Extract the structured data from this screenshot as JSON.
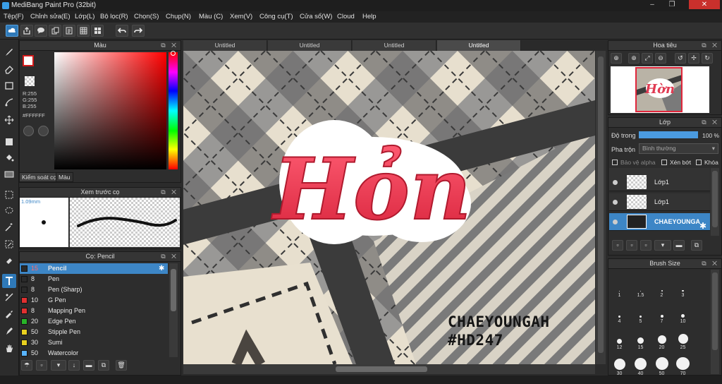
{
  "window": {
    "title": "MediBang Paint Pro (32bit)",
    "minimize": "–",
    "restore": "❐",
    "close": "✕"
  },
  "menu": [
    "Tệp(F)",
    "Chỉnh sửa(E)",
    "Lớp(L)",
    "Bộ lọc(R)",
    "Chọn(S)",
    "Chụp(N)",
    "Màu (C)",
    "Xem(V)",
    "Công cụ(T)",
    "Cửa sổ(W)",
    "Cloud",
    "Help"
  ],
  "color_panel": {
    "title": "Màu",
    "rgb": [
      "R:255",
      "G:255",
      "B:255"
    ],
    "hex": "#FFFFFF",
    "tabs": [
      "Kiểm soát cọ",
      "Màu"
    ]
  },
  "brush_preview": {
    "title": "Xem trước cọ",
    "size": "1.09mm"
  },
  "brush_list": {
    "title": "Cọ: Pencil",
    "items": [
      {
        "size": "15",
        "name": "Pencil",
        "color": "#2a2a2a"
      },
      {
        "size": "8",
        "name": "Pen",
        "color": "#2a2a2a"
      },
      {
        "size": "8",
        "name": "Pen (Sharp)",
        "color": "#2a2a2a"
      },
      {
        "size": "10",
        "name": "G Pen",
        "color": "#e03030"
      },
      {
        "size": "8",
        "name": "Mapping Pen",
        "color": "#e03030"
      },
      {
        "size": "20",
        "name": "Edge Pen",
        "color": "#28b428"
      },
      {
        "size": "50",
        "name": "Stipple Pen",
        "color": "#e8d020"
      },
      {
        "size": "30",
        "name": "Sumi",
        "color": "#e8d020"
      },
      {
        "size": "50",
        "name": "Watercolor",
        "color": "#58b4ff"
      }
    ]
  },
  "doc_tabs": [
    "Untitled",
    "Untitled",
    "Untitled",
    "Untitled"
  ],
  "canvas": {
    "title_art": "Hỏn",
    "caption_line1": "CHAEYOUNGAH",
    "caption_line2": "#HD247"
  },
  "navigator": {
    "title": "Hoa tiêu",
    "thumb_text": "Hờn"
  },
  "layers": {
    "title": "Lớp",
    "opacity_label": "Độ trong",
    "opacity_value": "100 %",
    "opacity_fraction": 1.0,
    "blend_label": "Pha trộn",
    "blend_value": "Bình thường",
    "protect_alpha": "Bảo vệ alpha",
    "clip": "Xén bớt",
    "lock": "Khóa",
    "items": [
      {
        "name": "Lớp1"
      },
      {
        "name": "Lớp1"
      },
      {
        "name": "CHAEYOUNGA"
      }
    ]
  },
  "brush_size": {
    "title": "Brush Size",
    "sizes": [
      "1",
      "1.5",
      "2",
      "3",
      "4",
      "5",
      "7",
      "10",
      "12",
      "15",
      "20",
      "25",
      "30",
      "40",
      "50",
      "70"
    ]
  },
  "colors": {
    "accent": "#3d86c6",
    "close": "#c9302c",
    "foreground": "#d21c1c"
  }
}
